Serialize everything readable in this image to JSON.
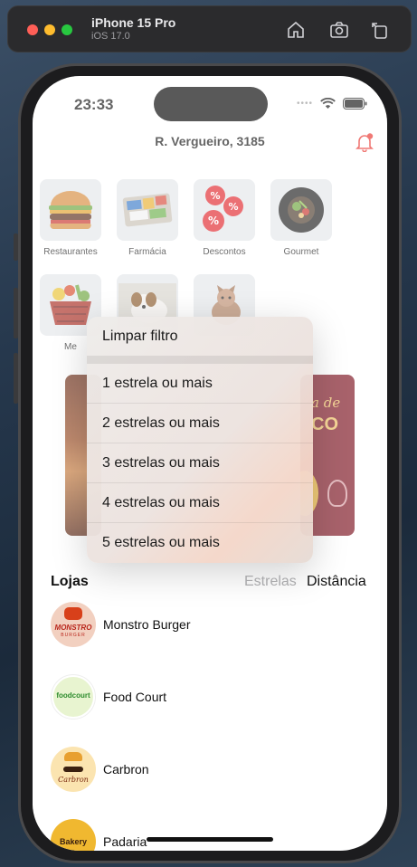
{
  "simulator": {
    "device_name": "iPhone 15 Pro",
    "os_version": "iOS 17.0",
    "buttons": [
      "home-icon",
      "screenshot-icon",
      "rotate-icon"
    ]
  },
  "status_bar": {
    "time": "23:33"
  },
  "header": {
    "address": "R. Vergueiro, 3185"
  },
  "categories": [
    {
      "label": "Restaurantes",
      "icon": "burger-icon"
    },
    {
      "label": "Farmácia",
      "icon": "pharmacy-icon"
    },
    {
      "label": "Descontos",
      "icon": "discount-icon"
    },
    {
      "label": "Gourmet",
      "icon": "gourmet-icon"
    },
    {
      "label": "Me",
      "icon": "market-basket-icon"
    },
    {
      "label": "",
      "icon": "dog-icon"
    },
    {
      "label": "",
      "icon": "cat-icon"
    }
  ],
  "banners": [
    {
      "name": "grill-banner"
    },
    {
      "name": "red-promo-banner",
      "text": "a de",
      "text2": "CO"
    }
  ],
  "filter_menu": {
    "clear": "Limpar filtro",
    "options": [
      "1 estrela ou mais",
      "2 estrelas ou mais",
      "3 estrelas ou mais",
      "4 estrelas ou mais",
      "5 estrelas ou mais"
    ]
  },
  "stores_section": {
    "title": "Lojas",
    "sort_stars": "Estrelas",
    "sort_distance": "Distância",
    "stores": [
      {
        "name": "Monstro Burger",
        "logo_text": "MONSTRO",
        "logo_sub": "BURGER"
      },
      {
        "name": "Food Court",
        "logo_text": "foodcourt"
      },
      {
        "name": "Carbron",
        "logo_text": "Carbron"
      },
      {
        "name": "Padaria",
        "logo_text": "Bakery"
      }
    ]
  },
  "colors": {
    "accent_red": "#e8322c",
    "sort_inactive": "#a9a9ab"
  }
}
